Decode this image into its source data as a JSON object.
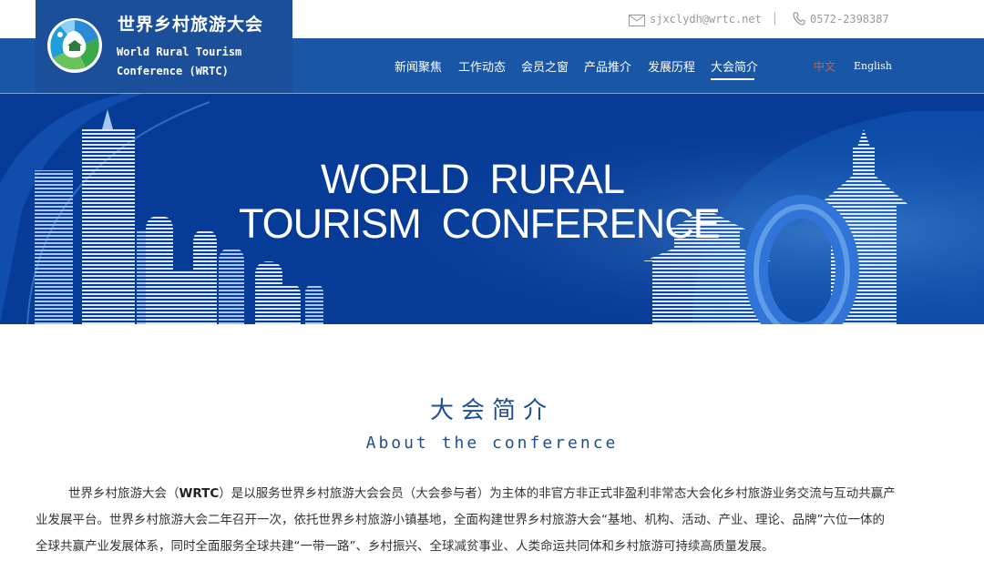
{
  "header": {
    "email": "sjxclydh@wrtc.net",
    "phone": "0572-2398387",
    "logo": {
      "title_cn": "世界乡村旅游大会",
      "title_en_line1": "World Rural Tourism",
      "title_en_line2": "Conference (WRTC)"
    },
    "nav": [
      {
        "label": "新闻聚焦",
        "active": false
      },
      {
        "label": "工作动态",
        "active": false
      },
      {
        "label": "会员之窗",
        "active": false
      },
      {
        "label": "产品推介",
        "active": false
      },
      {
        "label": "发展历程",
        "active": false
      },
      {
        "label": "大会简介",
        "active": true
      }
    ],
    "lang_cn": "中文",
    "lang_en": "English"
  },
  "banner": {
    "line1": "WORLD  RURAL",
    "line2": "TOURISM  CONFERENCE"
  },
  "section": {
    "title_cn": "大会简介",
    "title_en": "About the conference",
    "intro_bold": "WRTC",
    "intro_pre": "世界乡村旅游大会（",
    "intro_post": "）是以服务世界乡村旅游大会会员（大会参与者）为主体的非官方非正式非盈利非常态大会化乡村旅游业务交流与互动共赢产业发展平台。世界乡村旅游大会二年召开一次，依托世界乡村旅游小镇基地，全面构建世界乡村旅游大会“基地、机构、活动、产业、理论、品牌”六位一体的全球共赢产业发展体系，同时全面服务全球共建“一带一路”、乡村振兴、全球减贫事业、人类命运共同体和乡村旅游可持续高质量发展。"
  },
  "colors": {
    "nav_bg": "#1a56a6",
    "logo_bg": "#1c4f99",
    "banner_bg": "#063b98",
    "accent_red": "#e05a2a",
    "title_blue": "#1d4f95"
  },
  "icons": [
    "mail-icon",
    "phone-icon",
    "wrtc-logo-icon"
  ]
}
